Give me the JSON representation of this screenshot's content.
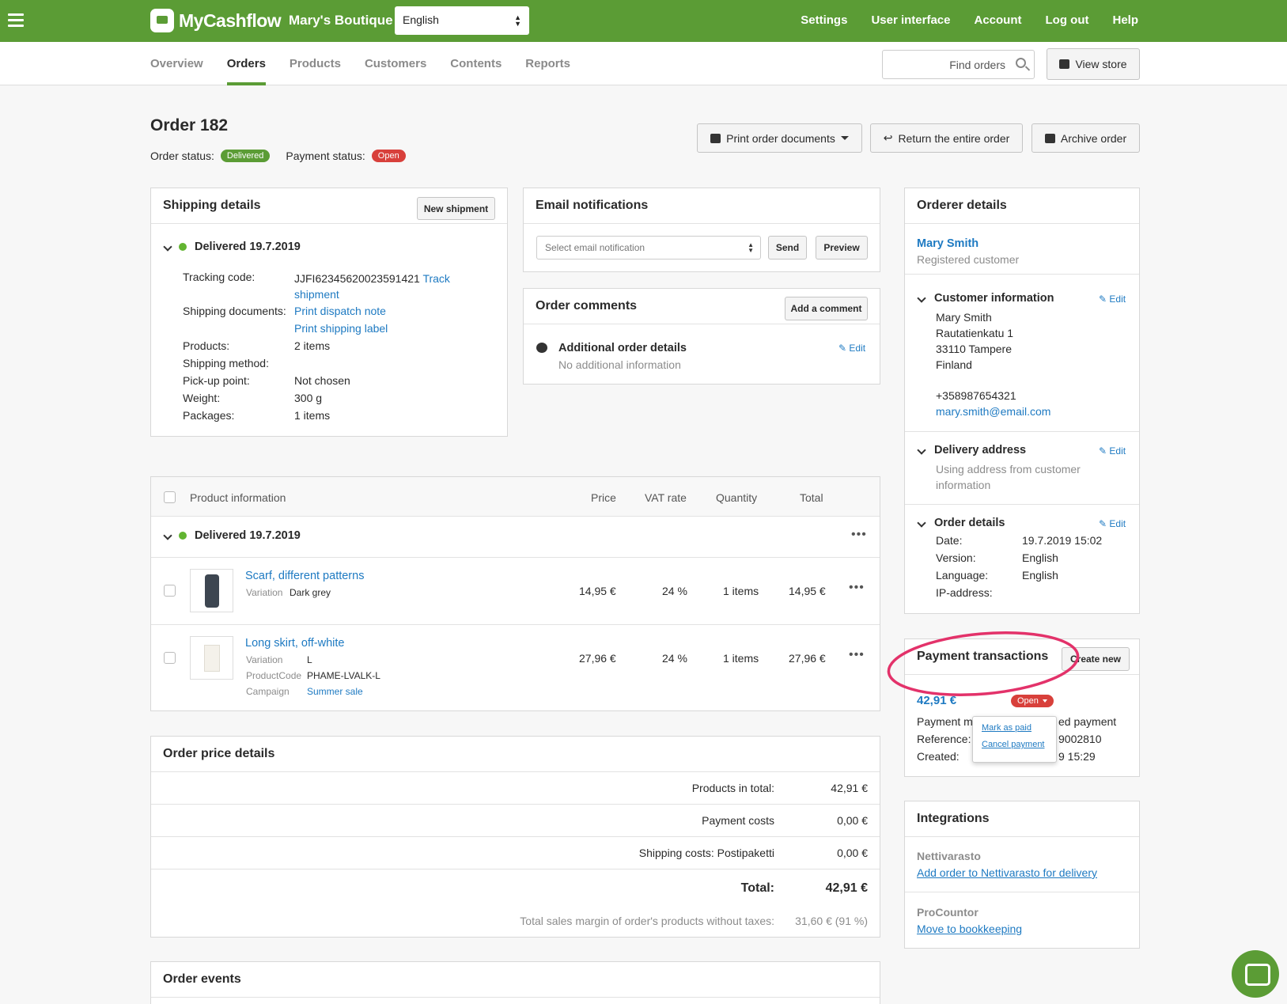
{
  "header": {
    "brand": "MyCashflow",
    "store_name": "Mary's Boutique",
    "language": "English",
    "nav": [
      "Settings",
      "User interface",
      "Account",
      "Log out",
      "Help"
    ]
  },
  "subnav": {
    "tabs": [
      "Overview",
      "Orders",
      "Products",
      "Customers",
      "Contents",
      "Reports"
    ],
    "active": "Orders",
    "search_placeholder": "Find orders",
    "view_store": "View store"
  },
  "order": {
    "title": "Order 182",
    "status_label": "Order status:",
    "status": "Delivered",
    "payment_label": "Payment status:",
    "payment_status": "Open",
    "actions": {
      "print": "Print order documents",
      "return": "Return the entire order",
      "archive": "Archive order"
    }
  },
  "shipping": {
    "title": "Shipping details",
    "new_btn": "New shipment",
    "shipment": "Delivered 19.7.2019",
    "tracking_label": "Tracking code:",
    "tracking_code": "JJFI62345620023591421",
    "track_link1": "Track",
    "track_link2": "shipment",
    "docs_label": "Shipping documents:",
    "doc1": "Print dispatch note",
    "doc2": "Print shipping label",
    "products_label": "Products:",
    "products": "2 items",
    "method_label": "Shipping method:",
    "method": "",
    "pickup_label": "Pick-up point:",
    "pickup": "Not chosen",
    "weight_label": "Weight:",
    "weight": "300 g",
    "packages_label": "Packages:",
    "packages": "1 items"
  },
  "email": {
    "title": "Email notifications",
    "select_placeholder": "Select email notification",
    "send": "Send",
    "preview": "Preview"
  },
  "comments": {
    "title": "Order comments",
    "add": "Add a comment",
    "sub_title": "Additional order details",
    "edit": "Edit",
    "empty": "No additional information"
  },
  "products_table": {
    "headers": [
      "Product information",
      "Price",
      "VAT rate",
      "Quantity",
      "Total"
    ],
    "group": "Delivered 19.7.2019",
    "items": [
      {
        "name": "Scarf, different patterns",
        "attrs": [
          [
            "Variation",
            "Dark grey"
          ]
        ],
        "price": "14,95 €",
        "vat": "24 %",
        "qty": "1 items",
        "total": "14,95 €"
      },
      {
        "name": "Long skirt, off-white",
        "attrs": [
          [
            "Variation",
            "L"
          ],
          [
            "ProductCode",
            "PHAME-LVALK-L"
          ],
          [
            "Campaign",
            "Summer sale"
          ]
        ],
        "price": "27,96 €",
        "vat": "24 %",
        "qty": "1 items",
        "total": "27,96 €"
      }
    ]
  },
  "price": {
    "title": "Order price details",
    "rows": [
      {
        "label": "Products in total:",
        "value": "42,91 €"
      },
      {
        "label": "Payment costs",
        "value": "0,00 €"
      },
      {
        "label": "Shipping costs: Postipaketti",
        "value": "0,00 €"
      }
    ],
    "total_label": "Total:",
    "total": "42,91 €",
    "margin_label": "Total sales margin of order's products without taxes:",
    "margin": "31,60 € (91 %)"
  },
  "events": {
    "title": "Order events"
  },
  "orderer": {
    "title": "Orderer details",
    "name": "Mary Smith",
    "type": "Registered customer",
    "customer_title": "Customer information",
    "edit": "Edit",
    "address": [
      "Mary Smith",
      "Rautatienkatu 1",
      "33110 Tampere",
      "Finland"
    ],
    "phone": "+358987654321",
    "email": "mary.smith@email.com",
    "delivery_title": "Delivery address",
    "delivery_line1": "Using address from customer",
    "delivery_line2": "information",
    "details_title": "Order details",
    "date_label": "Date:",
    "date": "19.7.2019 15:02",
    "version_label": "Version:",
    "version": "English",
    "language_label": "Language:",
    "language": "English",
    "ip_label": "IP-address:",
    "ip": ""
  },
  "payments": {
    "title": "Payment transactions",
    "create": "Create new",
    "amount": "42,91 €",
    "status": "Open",
    "method_label": "Payment m",
    "method_rest": "ed payment",
    "ref_label": "Reference:",
    "ref_rest": "9002810",
    "created_label": "Created:",
    "created_rest": "9 15:29",
    "menu": [
      "Mark as paid",
      "Cancel payment"
    ]
  },
  "integrations": {
    "title": "Integrations",
    "n1": "Nettivarasto",
    "l1": "Add order to Nettivarasto for delivery",
    "n2": "ProCountor",
    "l2": "Move to bookkeeping"
  },
  "colors": {
    "brand": "#5b9c35",
    "link": "#1e7ac2",
    "danger": "#d8403b",
    "highlight": "#e3326a"
  }
}
